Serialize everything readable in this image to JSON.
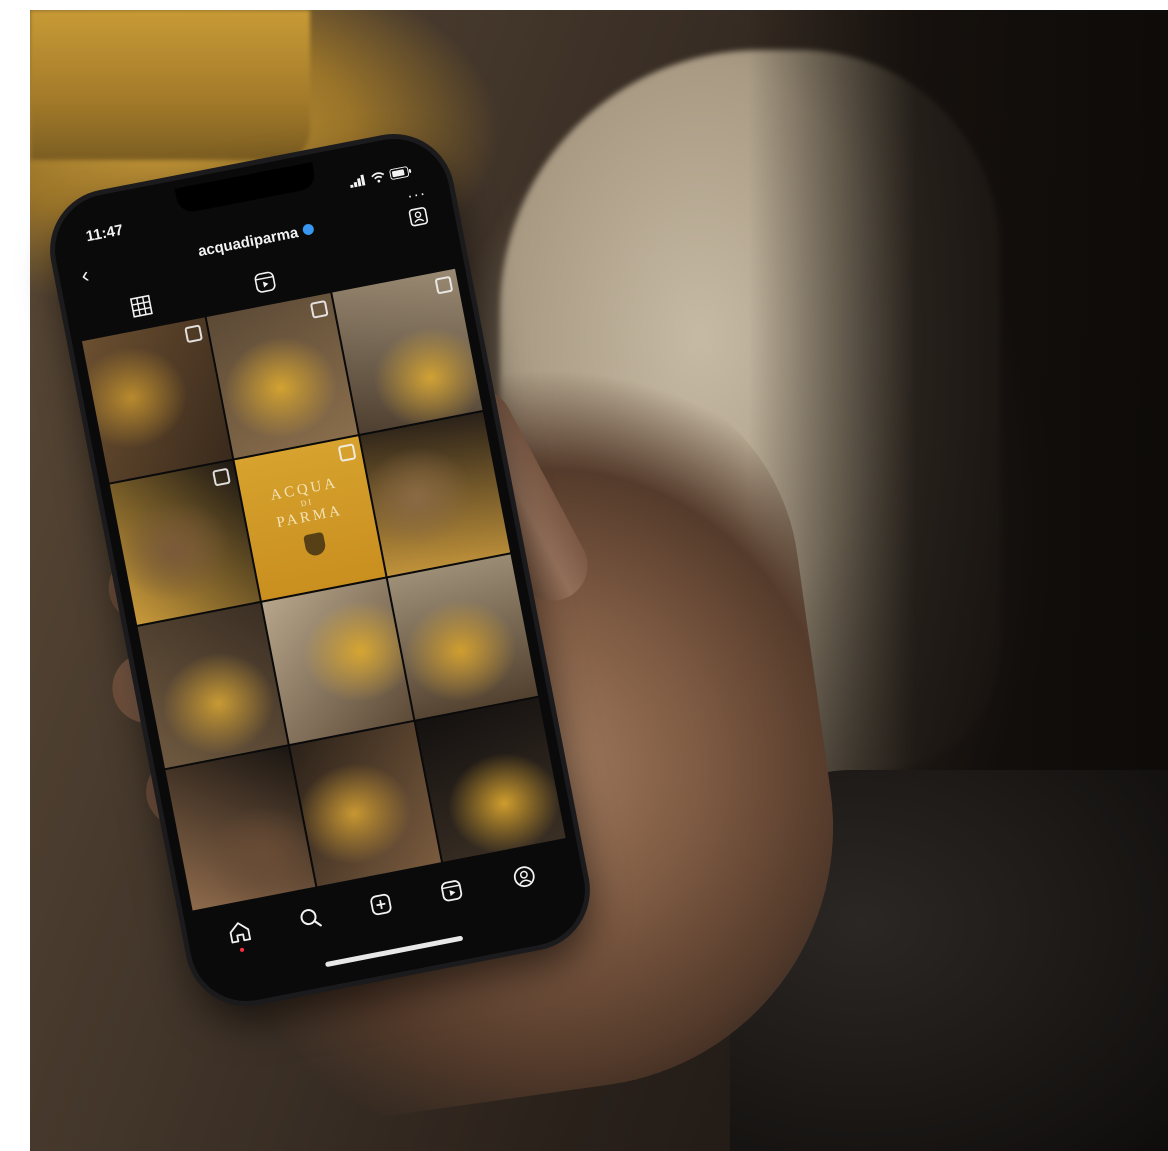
{
  "status_bar": {
    "time": "11:47",
    "icons": "..ıl ◠ ▭"
  },
  "header": {
    "account_name": "acquadiparma",
    "more": "···",
    "back": "‹"
  },
  "grid_posts": [
    {
      "kind": "photo",
      "tone": [
        "#6b4f30",
        "#b88a2e",
        "#3a2a1c"
      ],
      "multi": true
    },
    {
      "kind": "photo",
      "tone": [
        "#5c4a36",
        "#d2a231",
        "#8a6e4c"
      ],
      "multi": true
    },
    {
      "kind": "photo",
      "tone": [
        "#9a8a73",
        "#d0a134",
        "#4e3f30"
      ],
      "multi": true
    },
    {
      "kind": "photo",
      "tone": [
        "#1e1914",
        "#7a5a3a",
        "#c99a3a"
      ],
      "multi": true
    },
    {
      "kind": "logo",
      "multi": true,
      "logo": {
        "line1": "ACQUA",
        "di": "DI",
        "line2": "PARMA"
      }
    },
    {
      "kind": "photo",
      "tone": [
        "#2a2119",
        "#8a6a44",
        "#c0923a"
      ],
      "multi": false
    },
    {
      "kind": "photo",
      "tone": [
        "#3b2f24",
        "#c89a34",
        "#6e583f"
      ],
      "multi": false
    },
    {
      "kind": "photo",
      "tone": [
        "#b6a58a",
        "#d6a532",
        "#5d4b38"
      ],
      "multi": false
    },
    {
      "kind": "photo",
      "tone": [
        "#9e8f77",
        "#d09e30",
        "#52412f"
      ],
      "multi": false
    },
    {
      "kind": "photo",
      "tone": [
        "#1b1612",
        "#6a4c35",
        "#8e6a4b"
      ],
      "multi": false
    },
    {
      "kind": "photo",
      "tone": [
        "#2c2219",
        "#c89732",
        "#7a5b3e"
      ],
      "multi": false
    },
    {
      "kind": "photo",
      "tone": [
        "#141110",
        "#cf9d2e",
        "#3a2f24"
      ],
      "multi": false
    }
  ],
  "bottom_nav": {
    "active": "home"
  },
  "colors": {
    "accent_yellow": "#d7a22e",
    "verified_blue": "#3897f0",
    "notification_red": "#ff3040"
  }
}
